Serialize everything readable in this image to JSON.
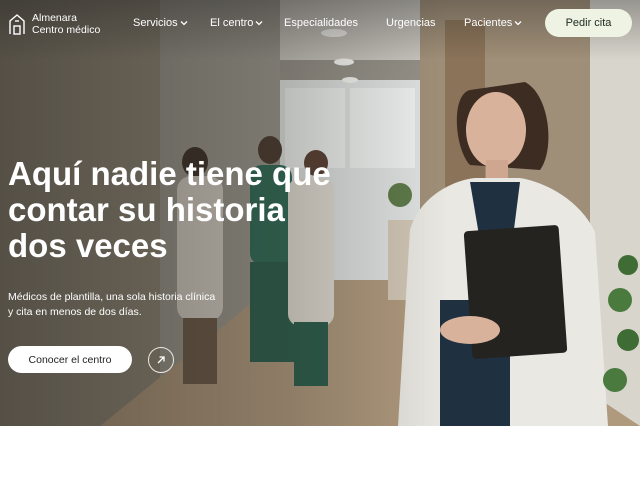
{
  "brand": {
    "line1": "Almenara",
    "line2": "Centro médico",
    "icon": "building-icon"
  },
  "nav": {
    "items": [
      {
        "label": "Servicios",
        "has_dropdown": true
      },
      {
        "label": "El centro",
        "has_dropdown": true
      },
      {
        "label": "Especialidades",
        "has_dropdown": false
      },
      {
        "label": "Urgencias",
        "has_dropdown": false
      },
      {
        "label": "Pacientes",
        "has_dropdown": true
      }
    ],
    "cta": "Pedir cita"
  },
  "hero": {
    "headline": [
      "Aquí nadie tiene que",
      "contar su historia",
      "dos veces"
    ],
    "subtitle": [
      "Médicos de plantilla, una sola historia clínica",
      "y cita en menos de dos días."
    ],
    "primary_button": "Conocer el centro",
    "arrow_icon": "arrow-up-right-icon"
  },
  "colors": {
    "cta_bg": "#eef3e4",
    "text_light": "#ffffff",
    "button_bg": "#ffffff"
  }
}
